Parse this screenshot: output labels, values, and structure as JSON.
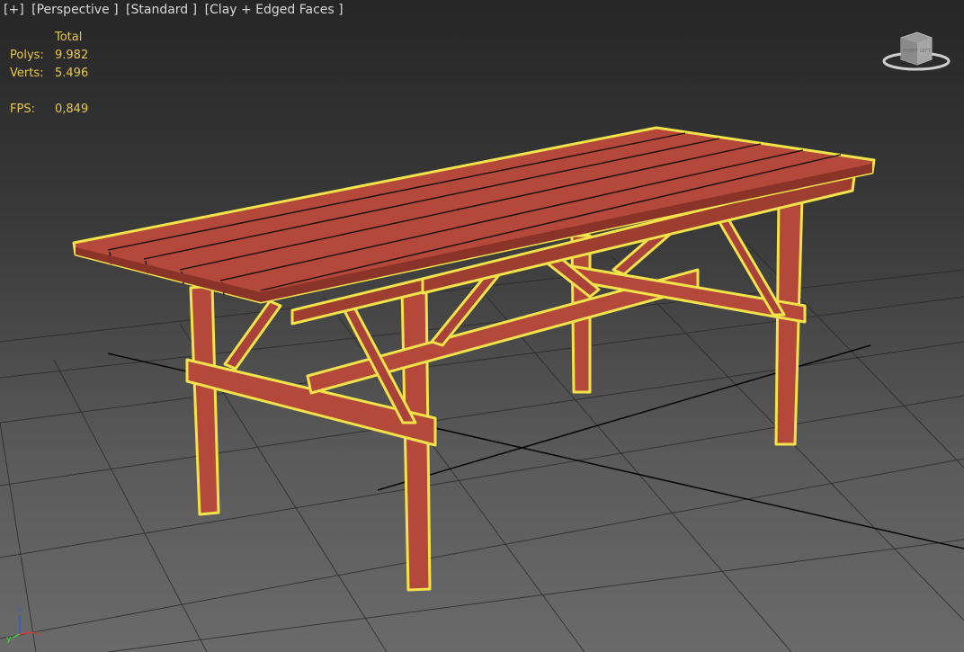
{
  "viewport": {
    "labels": [
      "[+]",
      "[Perspective ]",
      "[Standard ]",
      "[Clay + Edged Faces ]"
    ]
  },
  "stats": {
    "header": "Total",
    "polys_label": "Polys:",
    "polys_value": "9.982",
    "verts_label": "Verts:",
    "verts_value": "5.496",
    "fps_label": "FPS:",
    "fps_value": "0,849"
  },
  "viewcube": {
    "face_label": "FRONT",
    "side_label": "LEFT"
  },
  "axis": {
    "z": "z",
    "x": "x",
    "y": "y"
  },
  "colors": {
    "wood": "#b4483a",
    "wood_dark": "#8a3328",
    "selection": "#f3e34a",
    "grid": "#1a1a1a",
    "hud_text": "#e8c84a"
  }
}
